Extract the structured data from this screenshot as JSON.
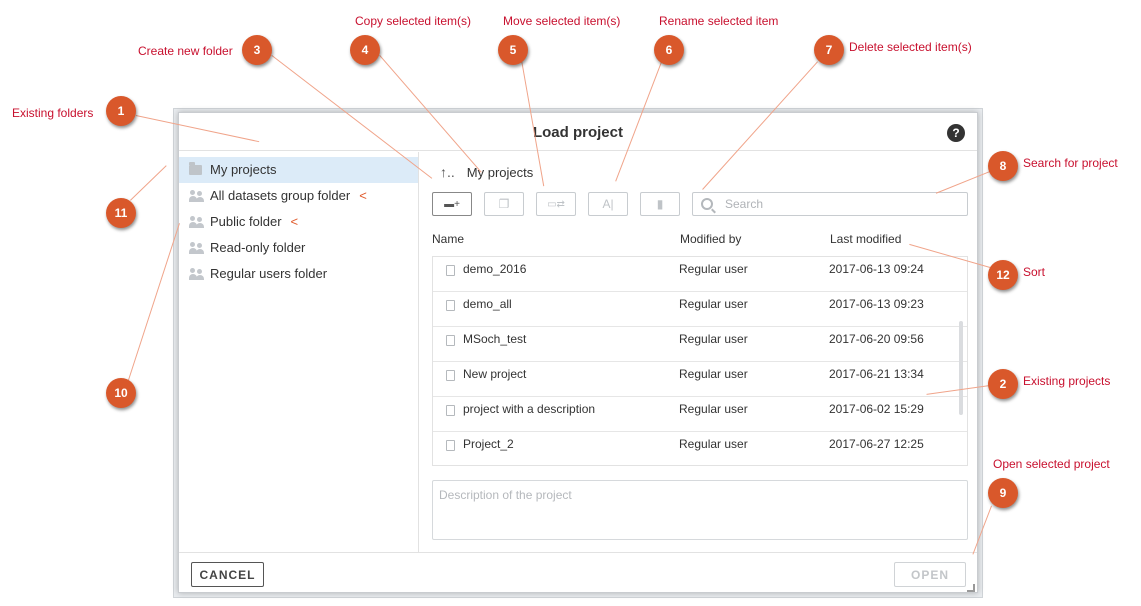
{
  "dialog": {
    "title": "Load project",
    "help_icon": "?"
  },
  "sidebar": {
    "items": [
      {
        "label": "My projects",
        "icon": "folder-icon",
        "selected": true,
        "shared": false
      },
      {
        "label": "All datasets group folder",
        "icon": "group-icon",
        "selected": false,
        "shared": true
      },
      {
        "label": "Public folder",
        "icon": "group-icon",
        "selected": false,
        "shared": true
      },
      {
        "label": "Read-only folder",
        "icon": "group-icon",
        "selected": false,
        "shared": false
      },
      {
        "label": "Regular users folder",
        "icon": "group-icon",
        "selected": false,
        "shared": false
      }
    ],
    "shared_marker": "<"
  },
  "breadcrumb": {
    "up_icon": "↑..",
    "current": "My projects"
  },
  "toolbar": {
    "buttons": [
      {
        "name": "create-folder",
        "icon": "new-folder-icon",
        "glyph": "▬+",
        "enabled": true
      },
      {
        "name": "copy",
        "icon": "copy-icon",
        "glyph": "❐",
        "enabled": false
      },
      {
        "name": "move",
        "icon": "move-icon",
        "glyph": "▭⇄",
        "enabled": false
      },
      {
        "name": "rename",
        "icon": "rename-icon",
        "glyph": "A|",
        "enabled": false
      },
      {
        "name": "delete",
        "icon": "trash-icon",
        "glyph": "▮",
        "enabled": false
      }
    ],
    "search_placeholder": "Search"
  },
  "table": {
    "headers": [
      "Name",
      "Modified by",
      "Last modified"
    ],
    "rows": [
      {
        "name": "demo_2016",
        "modified_by": "Regular user",
        "last_modified": "2017-06-13 09:24"
      },
      {
        "name": "demo_all",
        "modified_by": "Regular user",
        "last_modified": "2017-06-13 09:23"
      },
      {
        "name": "MSoch_test",
        "modified_by": "Regular user",
        "last_modified": "2017-06-20 09:56"
      },
      {
        "name": "New project",
        "modified_by": "Regular user",
        "last_modified": "2017-06-21 13:34"
      },
      {
        "name": "project with a description",
        "modified_by": "Regular user",
        "last_modified": "2017-06-02 15:29"
      },
      {
        "name": "Project_2",
        "modified_by": "Regular user",
        "last_modified": "2017-06-27 12:25"
      }
    ]
  },
  "description": {
    "placeholder": "Description of the project"
  },
  "footer": {
    "cancel_label": "CANCEL",
    "open_label": "OPEN"
  },
  "callouts": [
    {
      "num": "1",
      "label": "Existing folders"
    },
    {
      "num": "2",
      "label": "Existing projects"
    },
    {
      "num": "3",
      "label": "Create new folder"
    },
    {
      "num": "4",
      "label": "Copy selected item(s)"
    },
    {
      "num": "5",
      "label": "Move selected item(s)"
    },
    {
      "num": "6",
      "label": "Rename selected item"
    },
    {
      "num": "7",
      "label": "Delete selected item(s)"
    },
    {
      "num": "8",
      "label": "Search for project"
    },
    {
      "num": "9",
      "label": "Open selected project"
    },
    {
      "num": "10",
      "label": ""
    },
    {
      "num": "11",
      "label": ""
    },
    {
      "num": "12",
      "label": "Sort"
    }
  ],
  "colors": {
    "accent_badge": "#d9582b",
    "callout_text": "#c8102e",
    "selected_row": "#dcebf8",
    "shared_marker": "#e05a2b"
  }
}
